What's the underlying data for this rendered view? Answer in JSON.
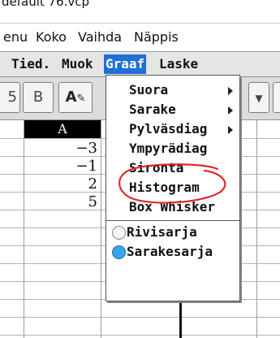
{
  "title": {
    "file_name": "default 76.vcp"
  },
  "menubar": {
    "items": [
      "enu",
      "Koko",
      "Vaihda",
      "Näppis"
    ]
  },
  "appbar": {
    "items": [
      "Tied.",
      "Muok",
      "Graaf",
      "Laske"
    ],
    "active": "Graaf"
  },
  "toolbar": {
    "left_partial": "5",
    "bold_button": "B",
    "format_button": "A"
  },
  "sheet": {
    "column_header": "A",
    "values": [
      "−3",
      "−1",
      "2",
      "5"
    ]
  },
  "dropdown": {
    "items": [
      {
        "label": "Suora",
        "submenu": true
      },
      {
        "label": "Sarake",
        "submenu": true
      },
      {
        "label": "Pylväsdiag",
        "submenu": true
      },
      {
        "label": "Ympyrädiag",
        "submenu": false
      },
      {
        "label": "Sironta",
        "submenu": false
      },
      {
        "label": "Histogram",
        "submenu": false
      },
      {
        "label": "Box Whisker",
        "submenu": false
      }
    ],
    "radio_items": [
      {
        "label": "Rivisarja",
        "selected": false
      },
      {
        "label": "Sarakesarja",
        "selected": true
      }
    ]
  },
  "colors": {
    "active_menu": "#1f6fd6",
    "radio_selected": "#3aa4e6",
    "annotation_circle": "#e0282a"
  }
}
